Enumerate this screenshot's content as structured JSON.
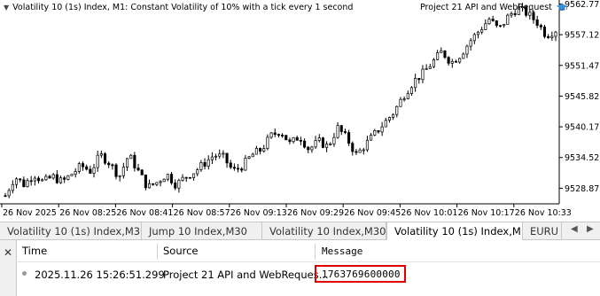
{
  "chart": {
    "title": "Volatility 10 (1s) Index, M1:  Constant Volatility of 10% with a tick every 1 second",
    "ea_name": "Project 21 API and WebRequest",
    "ea_icon": "graduation-cap-icon",
    "price_labels": [
      "9562.77",
      "9557.12",
      "9551.47",
      "9545.82",
      "9540.17",
      "9534.52",
      "9528.87"
    ],
    "time_labels": [
      "26 Nov 2025",
      "26 Nov 08:25",
      "26 Nov 08:41",
      "26 Nov 08:57",
      "26 Nov 09:13",
      "26 Nov 09:29",
      "26 Nov 09:45",
      "26 Nov 10:01",
      "26 Nov 10:17",
      "26 Nov 10:33"
    ],
    "colors": {
      "up": "#ffffff",
      "down": "#000000",
      "grid": "#c0c0c0"
    }
  },
  "chart_data": {
    "type": "candlestick",
    "ylim": [
      9526.0,
      9563.5
    ],
    "close_path": [
      9527.5,
      9531,
      9529.5,
      9531.5,
      9530,
      9531,
      9530,
      9531.5,
      9533,
      9532,
      9535,
      9533.5,
      9531,
      9535,
      9532,
      9529,
      9530,
      9531.5,
      9529.5,
      9531,
      9532,
      9533.5,
      9535,
      9534.5,
      9532,
      9533,
      9535,
      9536,
      9538.5,
      9539.5,
      9537,
      9538.5,
      9536,
      9537.5,
      9536.5,
      9540,
      9538,
      9535,
      9537,
      9539,
      9541,
      9543,
      9546,
      9548.5,
      9550,
      9552,
      9554,
      9552,
      9553.5,
      9556,
      9558,
      9560,
      9558,
      9560.5,
      9562,
      9561,
      9559.5,
      9557,
      9558
    ]
  },
  "tabs": [
    {
      "label": "Volatility 10 (1s) Index,M30"
    },
    {
      "label": "Jump 10 Index,M30"
    },
    {
      "label": "Volatility 10 Index,M30"
    },
    {
      "label": "Volatility 10 (1s) Index,M1"
    },
    {
      "label": "EURU"
    }
  ],
  "log": {
    "columns": [
      "Time",
      "Source",
      "Message"
    ],
    "rows": [
      {
        "time": "2025.11.26 15:26:51.299",
        "source": "Project 21 API and WebReques...",
        "message": "1763769600000"
      }
    ],
    "highlight_color": "#e00000"
  }
}
